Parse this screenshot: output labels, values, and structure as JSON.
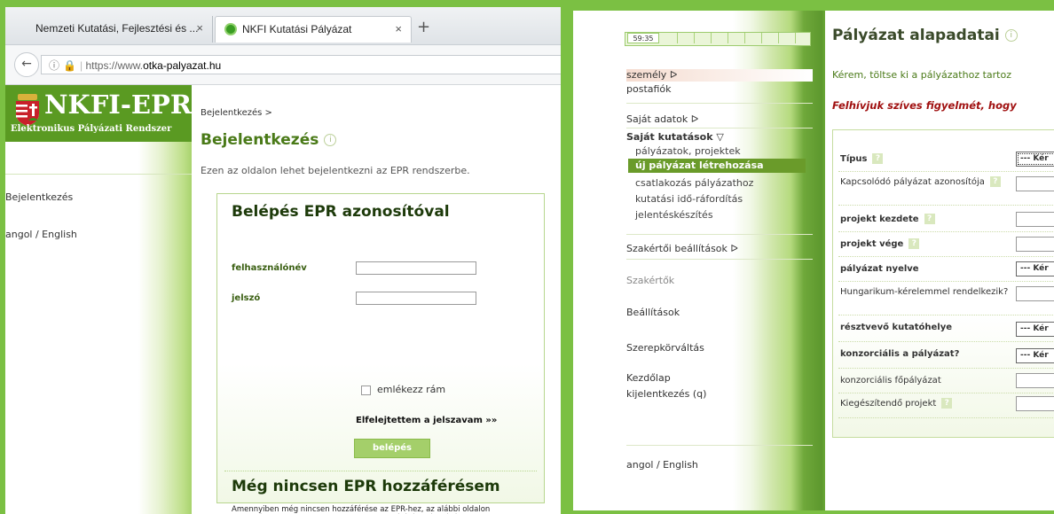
{
  "browser": {
    "tabs": [
      {
        "label": "Nemzeti Kutatási, Fejlesztési és ...",
        "close": "×"
      },
      {
        "label": "NKFI Kutatási Pályázat",
        "close": "×"
      }
    ],
    "new_tab": "+",
    "url": {
      "prefix": "https://www.",
      "domain": "otka-palyazat.hu"
    }
  },
  "left": {
    "logo": {
      "brand": "NKFI-EPR",
      "subtitle": "Elektronikus Pályázati Rendszer"
    },
    "nav": [
      "Bejelentkezés",
      "angol / English"
    ],
    "breadcrumb": "Bejelentkezés >",
    "title": "Bejelentkezés",
    "intro": "Ezen az oldalon lehet bejelentkezni az EPR rendszerbe.",
    "login": {
      "heading": "Belépés EPR azonosítóval",
      "username_label": "felhasználónév",
      "password_label": "jelszó",
      "remember_label": "emlékezz rám",
      "forgot_label": "Elfelejtettem a jelszavam »»",
      "submit_label": "belépés"
    },
    "no_access": {
      "heading": "Még nincsen EPR hozzáférésem",
      "text": "Amennyiben még nincsen hozzáférése az EPR-hez, az alábbi oldalon megtalálhatja, hogy kihez kell fordulni hozzáférés igényléséhez. »»"
    }
  },
  "right": {
    "timer": "59:35",
    "menu": {
      "szemely": "személy ᐅ",
      "postafiok": "postafiók",
      "sajat_adatok": "Saját adatok ᐅ",
      "sajat_kutatasok": "Saját kutatások ▽",
      "sub": [
        "pályázatok, projektek",
        "új pályázat létrehozása",
        "csatlakozás pályázathoz",
        "kutatási idő-ráfordítás",
        "jelentéskészítés"
      ],
      "szakertoi": "Szakértői beállítások ᐅ",
      "szakertok": "Szakértők",
      "beallitasok": "Beállítások",
      "szerepkor": "Szerepkörváltás",
      "kezdolap": "Kezdőlap",
      "kijelentkezes": "kijelentkezés (q)",
      "lang": "angol / English"
    },
    "title": "Pályázat alapadatai",
    "desc": "Kérem, töltse ki a pályázathoz tartoz",
    "warning": "Felhívjuk szíves figyelmét, hogy",
    "fields": [
      {
        "label": "Típus",
        "bold": true,
        "help": true,
        "select": "--- Kér"
      },
      {
        "label": "Kapcsolódó pályázat azonosítója",
        "bold": false,
        "help": true
      },
      {
        "label": "projekt kezdete",
        "bold": true,
        "help": true
      },
      {
        "label": "projekt vége",
        "bold": true,
        "help": true
      },
      {
        "label": "pályázat nyelve",
        "bold": true,
        "help": false,
        "select": "--- Kér"
      },
      {
        "label": "Hungarikum-kérelemmel rendelkezik?",
        "bold": false,
        "help": false
      },
      {
        "label": "résztvevő kutatóhelye",
        "bold": true,
        "help": false,
        "select": "--- Kér"
      },
      {
        "label": "konzorciális a pályázat?",
        "bold": true,
        "help": false,
        "select": "--- Kér"
      },
      {
        "label": "konzorciális főpályázat",
        "bold": false,
        "help": false
      },
      {
        "label": "Kiegészítendő projekt",
        "bold": false,
        "help": true
      }
    ]
  }
}
